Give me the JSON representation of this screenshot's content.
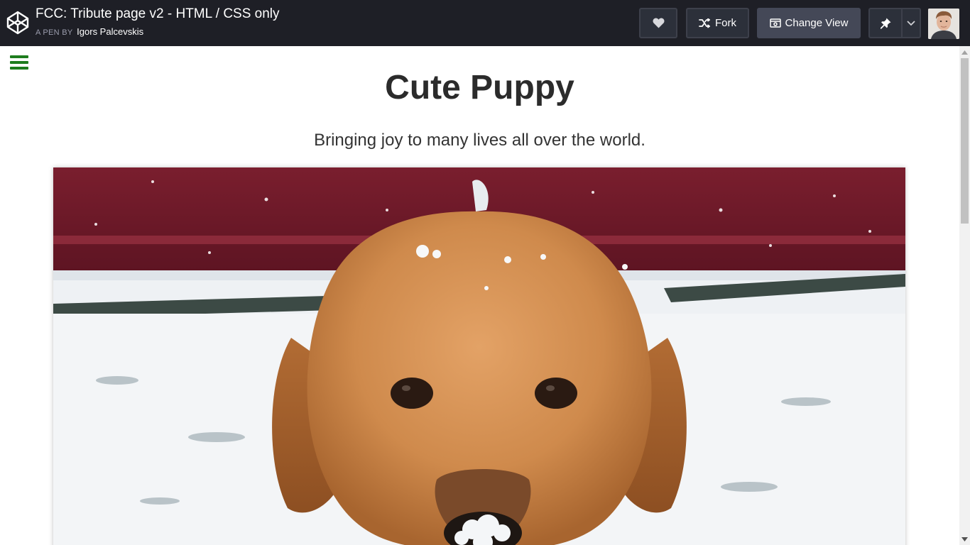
{
  "header": {
    "title": "FCC: Tribute page v2 - HTML / CSS only",
    "by_label": "A PEN BY",
    "author": "Igors Palcevskis",
    "buttons": {
      "like_icon": "heart-icon",
      "fork_label": "Fork",
      "change_view_label": "Change View",
      "pin_icon": "pin-icon"
    }
  },
  "page": {
    "menu_icon": "hamburger-menu-icon",
    "heading": "Cute Puppy",
    "tagline": "Bringing joy to many lives all over the world.",
    "image_subject": "golden retriever puppy in snow"
  },
  "colors": {
    "topbar_bg": "#1e1f26",
    "menu_accent": "#1e7d1e",
    "heading_text": "#2b2b2b"
  }
}
